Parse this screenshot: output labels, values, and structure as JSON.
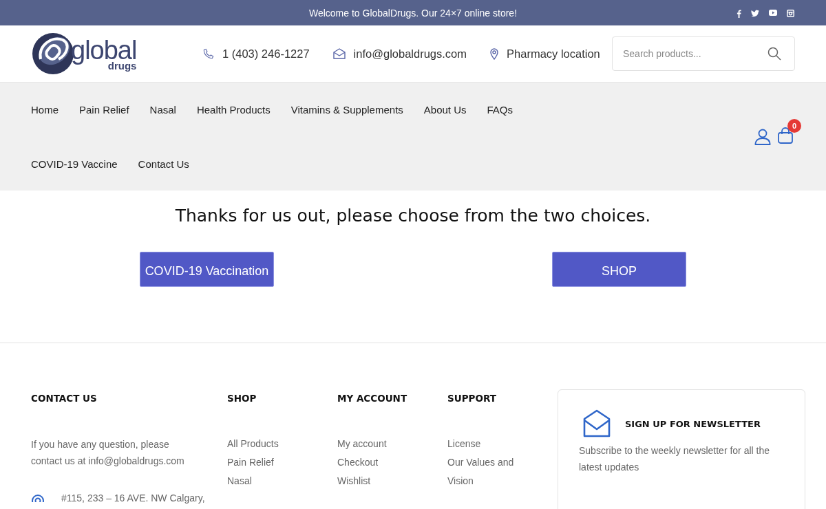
{
  "top_bar": {
    "message": "Welcome to GlobalDrugs. Our 24×7 online store!",
    "social": [
      {
        "kind": "facebook"
      },
      {
        "kind": "twitter"
      },
      {
        "kind": "youtube"
      },
      {
        "kind": "instagram"
      }
    ]
  },
  "header": {
    "logo": {
      "word": "global",
      "sub": "drugs"
    },
    "contacts": [
      {
        "kind": "phone",
        "text": "1 (403) 246-1227"
      },
      {
        "kind": "email",
        "text": "info@globaldrugs.com"
      },
      {
        "kind": "location",
        "text": "Pharmacy location"
      }
    ],
    "search": {
      "placeholder": "Search products..."
    }
  },
  "nav": {
    "links": [
      "Home",
      "Pain Relief",
      "Nasal",
      "Health Products",
      "Vitamins & Supplements",
      "About Us",
      "FAQs",
      "COVID-19 Vaccine",
      "Contact Us"
    ],
    "cart_count": "0"
  },
  "main": {
    "heading": "Thanks for us out, please choose from the two choices.",
    "buttons": [
      "COVID-19 Vaccination",
      "SHOP"
    ]
  },
  "footer": {
    "contact": {
      "title": "CONTACT US",
      "text": "If you have any question, please contact us at info@globaldrugs.com",
      "address": "#115, 233 – 16 AVE. NW Calgary,"
    },
    "columns": [
      {
        "title": "SHOP",
        "links": [
          "All Products",
          "Pain Relief",
          "Nasal"
        ]
      },
      {
        "title": "MY ACCOUNT",
        "links": [
          "My account",
          "Checkout",
          "Wishlist"
        ]
      },
      {
        "title": "SUPPORT",
        "links": [
          "License",
          "Our Values and",
          "Vision"
        ]
      }
    ],
    "newsletter": {
      "title": "SIGN UP FOR NEWSLETTER",
      "text": "Subscribe to the weekly newsletter for all the latest updates"
    }
  }
}
